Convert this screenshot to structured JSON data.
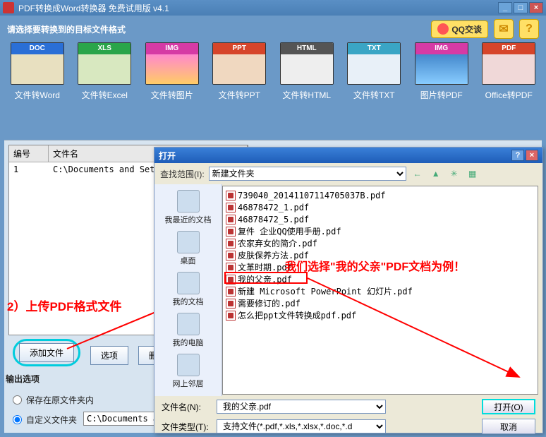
{
  "titlebar": {
    "title": "PDF转换成Word转换器 免费试用版 v4.1"
  },
  "prompt": "请选择要转换到的目标文件格式",
  "qq": "QQ交谈",
  "tiles": [
    {
      "tag": "DOC",
      "tagbg": "#2a6fd6",
      "art": "#e8e0c0",
      "label": "文件转Word"
    },
    {
      "tag": "XLS",
      "tagbg": "#2aa54a",
      "art": "#d8e8c0",
      "label": "文件转Excel"
    },
    {
      "tag": "IMG",
      "tagbg": "#d63aa5",
      "art": "linear-gradient(#f8c,#fc6)",
      "label": "文件转图片"
    },
    {
      "tag": "PPT",
      "tagbg": "#d6452a",
      "art": "#f0d8c0",
      "label": "文件转PPT"
    },
    {
      "tag": "HTML",
      "tagbg": "#555",
      "art": "#eee",
      "label": "文件转HTML"
    },
    {
      "tag": "TXT",
      "tagbg": "#3aa5c5",
      "art": "#e8f0f8",
      "label": "文件转TXT"
    },
    {
      "tag": "IMG",
      "tagbg": "#d63aa5",
      "art": "linear-gradient(#48c,#8cf)",
      "label": "图片转PDF"
    },
    {
      "tag": "PDF",
      "tagbg": "#d6452a",
      "art": "#f0d8d8",
      "label": "Office转PDF"
    }
  ],
  "table": {
    "h1": "编号",
    "h2": "文件名",
    "r1c1": "1",
    "r1c2": "C:\\Documents and Settin"
  },
  "ann_upload": "2）上传PDF格式文件",
  "btn_add": "添加文件",
  "btn_opt": "选项",
  "btn_del": "删",
  "out_hdr": "输出选项",
  "r_keep": "保存在原文件夹内",
  "r_custom": "自定义文件夹",
  "custom_path": "C:\\Documents and ",
  "dialog": {
    "title": "打开",
    "look_lbl": "查找范围(I):",
    "look_val": "新建文件夹",
    "places": [
      "我最近的文档",
      "桌面",
      "我的文档",
      "我的电脑",
      "网上邻居"
    ],
    "files": [
      "739040_20141107114705037B.pdf",
      "46878472_1.pdf",
      "46878472_5.pdf",
      "复件 企业QQ使用手册.pdf",
      "农家弃女的简介.pdf",
      "皮肤保养方法.pdf",
      "文革时期.pdf",
      "我的父亲.pdf",
      "新建 Microsoft PowerPoint 幻灯片.pdf",
      "需要修订的.pdf",
      "怎么把ppt文件转换成pdf.pdf"
    ],
    "ann_select": "我们选择\"我的父亲\"PDF文档为例！",
    "fn_lbl": "文件名(N):",
    "fn_val": "我的父亲.pdf",
    "ft_lbl": "文件类型(T):",
    "ft_val": "支持文件(*.pdf,*.xls,*.xlsx,*.doc,*.d",
    "open": "打开(O)",
    "cancel": "取消"
  }
}
